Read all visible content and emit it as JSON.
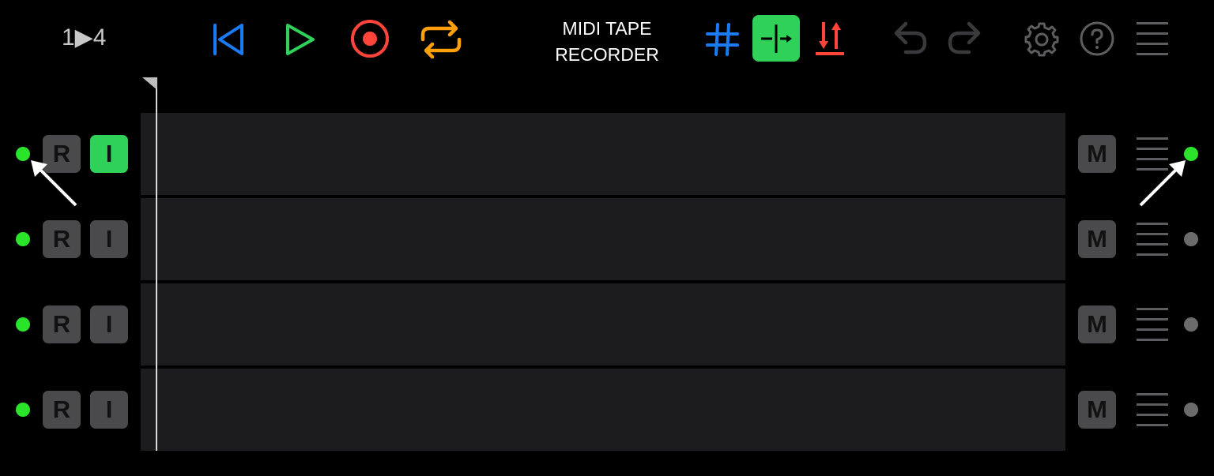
{
  "toolbar": {
    "counter": "1▶4",
    "title_line1": "MIDI TAPE",
    "title_line2": "RECORDER",
    "icons": {
      "rewind": "skip-to-start-icon",
      "play": "play-icon",
      "record": "record-icon",
      "loop": "loop-icon",
      "grid": "grid-icon",
      "split": "split-icon",
      "transpose": "transpose-icon",
      "undo": "undo-icon",
      "redo": "redo-icon",
      "settings": "gear-icon",
      "help": "help-icon",
      "menu": "hamburger-menu-icon"
    },
    "colors": {
      "rewind": "#1a7cf5",
      "play": "#2fd158",
      "record": "#ff453a",
      "loop": "#ff9f0a",
      "grid": "#1a7cf5",
      "split_bg": "#2fd158",
      "transpose": "#ff453a",
      "inactive": "#3a3a3c"
    }
  },
  "tracks": [
    {
      "record_label": "R",
      "input_label": "I",
      "mute_label": "M",
      "input_active": true,
      "left_led": "green",
      "right_led": "green"
    },
    {
      "record_label": "R",
      "input_label": "I",
      "mute_label": "M",
      "input_active": false,
      "left_led": "green",
      "right_led": "grey"
    },
    {
      "record_label": "R",
      "input_label": "I",
      "mute_label": "M",
      "input_active": false,
      "left_led": "green",
      "right_led": "grey"
    },
    {
      "record_label": "R",
      "input_label": "I",
      "mute_label": "M",
      "input_active": false,
      "left_led": "green",
      "right_led": "grey"
    }
  ]
}
